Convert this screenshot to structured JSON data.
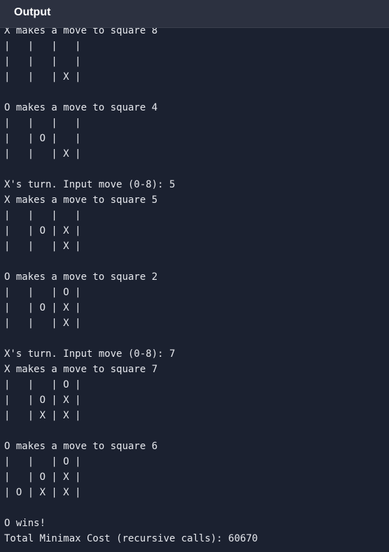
{
  "panel": {
    "title": "Output"
  },
  "console": {
    "lines": [
      "X makes a move to square 8",
      "|   |   |   |",
      "|   |   |   |",
      "|   |   | X |",
      "",
      "O makes a move to square 4",
      "|   |   |   |",
      "|   | O |   |",
      "|   |   | X |",
      "",
      "X's turn. Input move (0-8): 5",
      "X makes a move to square 5",
      "|   |   |   |",
      "|   | O | X |",
      "|   |   | X |",
      "",
      "O makes a move to square 2",
      "|   |   | O |",
      "|   | O | X |",
      "|   |   | X |",
      "",
      "X's turn. Input move (0-8): 7",
      "X makes a move to square 7",
      "|   |   | O |",
      "|   | O | X |",
      "|   | X | X |",
      "",
      "O makes a move to square 6",
      "|   |   | O |",
      "|   | O | X |",
      "| O | X | X |",
      "",
      "O wins!",
      "Total Minimax Cost (recursive calls): 60670"
    ]
  }
}
